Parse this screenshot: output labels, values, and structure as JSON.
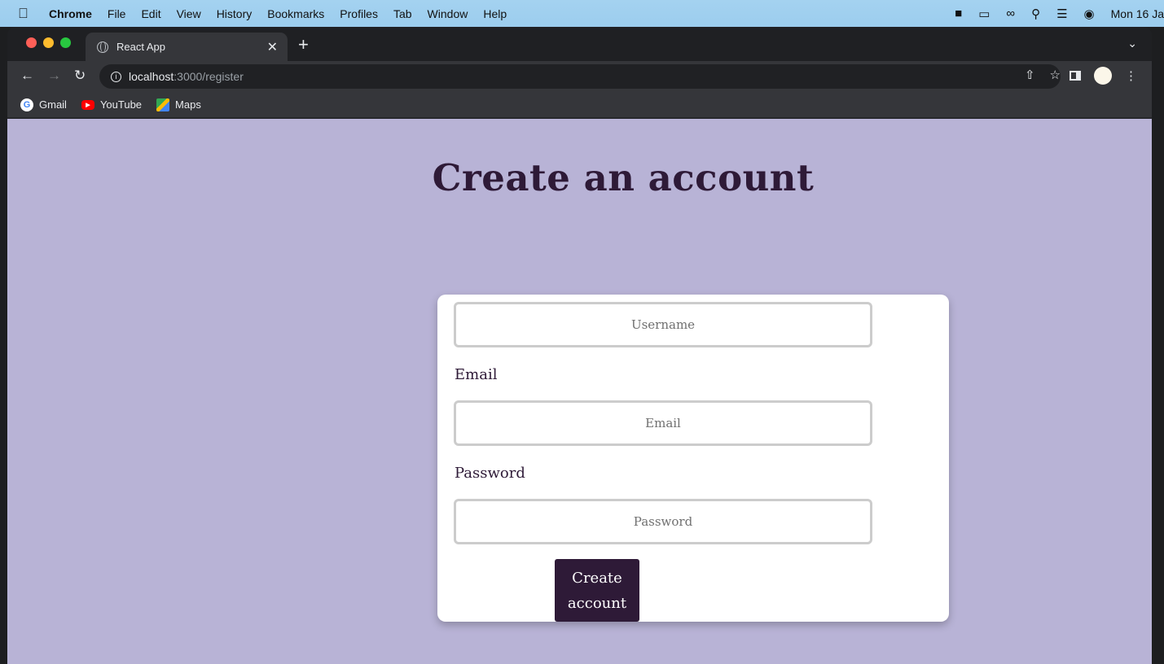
{
  "menubar": {
    "app": "Chrome",
    "items": [
      "File",
      "Edit",
      "View",
      "History",
      "Bookmarks",
      "Profiles",
      "Tab",
      "Window",
      "Help"
    ],
    "clock": "Mon 16 Ja"
  },
  "browser": {
    "tab_title": "React App",
    "url_host": "localhost",
    "url_path": ":3000/register",
    "bookmarks": [
      "Gmail",
      "YouTube",
      "Maps"
    ]
  },
  "page": {
    "title": "Create an account",
    "username_placeholder": "Username",
    "email_label": "Email",
    "email_placeholder": "Email",
    "password_label": "Password",
    "password_placeholder": "Password",
    "submit_line1": "Create",
    "submit_line2": "account"
  },
  "colors": {
    "page_bg": "#b8b3d6",
    "accent": "#2e1a37",
    "card_bg": "#ffffff"
  }
}
